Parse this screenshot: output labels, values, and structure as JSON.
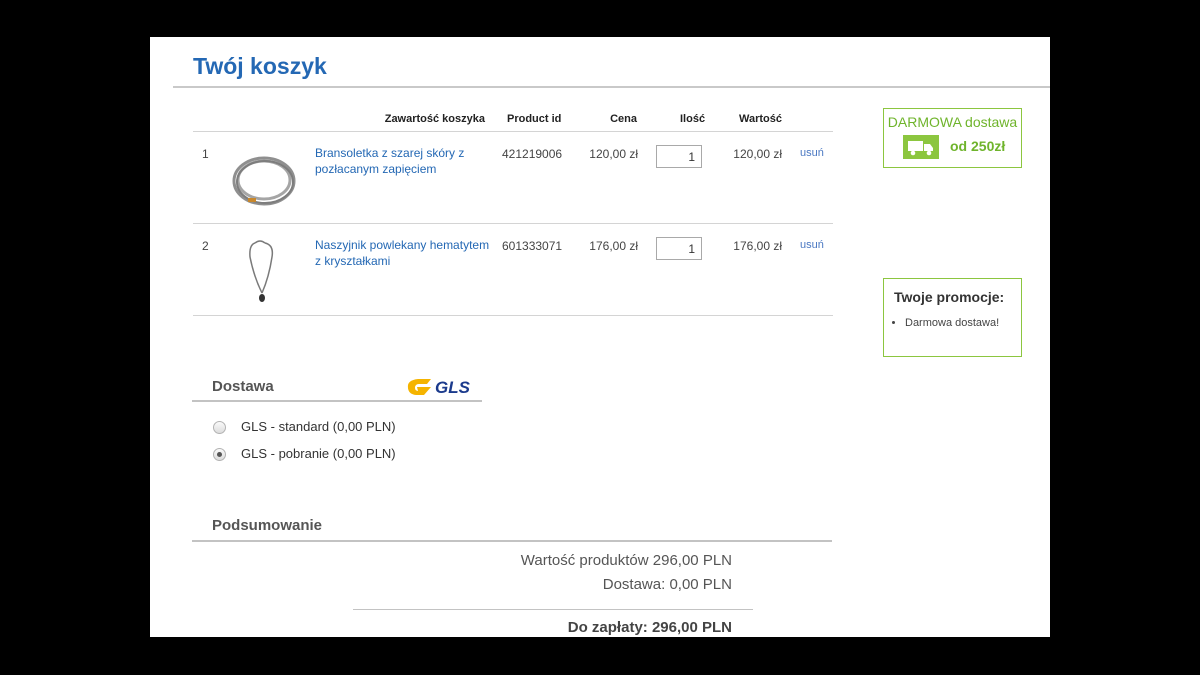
{
  "page": {
    "title": "Twój koszyk"
  },
  "cart": {
    "headers": {
      "content": "Zawartość koszyka",
      "product_id": "Product id",
      "price": "Cena",
      "quantity": "Ilość",
      "value": "Wartość"
    },
    "items": [
      {
        "index": "1",
        "name": "Bransoletka z szarej skóry z pozłacanym zapięciem",
        "product_id": "421219006",
        "price": "120,00 zł",
        "quantity": "1",
        "value": "120,00 zł",
        "remove_label": "usuń",
        "image_icon": "bracelet-image"
      },
      {
        "index": "2",
        "name": "Naszyjnik powlekany hematytem z kryształkami",
        "product_id": "601333071",
        "price": "176,00 zł",
        "quantity": "1",
        "value": "176,00 zł",
        "remove_label": "usuń",
        "image_icon": "necklace-image"
      }
    ]
  },
  "free_shipping": {
    "title": "DARMOWA dostawa",
    "amount": "od 250zł",
    "icon": "truck-icon"
  },
  "promotions": {
    "title": "Twoje promocje:",
    "items": [
      "Darmowa dostawa!"
    ]
  },
  "delivery": {
    "title": "Dostawa",
    "logo_text": "GLS",
    "options": [
      {
        "label": "GLS - standard (0,00 PLN)",
        "selected": false
      },
      {
        "label": "GLS - pobranie (0,00 PLN)",
        "selected": true
      }
    ]
  },
  "summary": {
    "title": "Podsumowanie",
    "products_value": "Wartość produktów 296,00 PLN",
    "delivery": "Dostawa: 0,00 PLN",
    "total": "Do zapłaty: 296,00 PLN"
  },
  "colors": {
    "brand_blue": "#2468b4",
    "accent_green": "#8cc63f",
    "gls_blue": "#1b3a8c",
    "gls_yellow": "#f5b400"
  }
}
